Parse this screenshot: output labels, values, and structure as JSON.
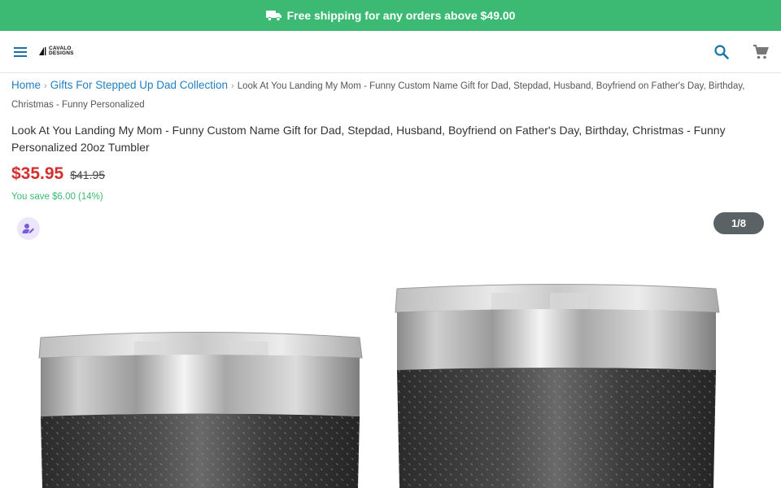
{
  "promo": {
    "text": "Free shipping for any orders above $49.00",
    "icon": "truck-icon",
    "background": "#3cba74"
  },
  "header": {
    "menu_icon": "hamburger-menu-icon",
    "logo_text_line1": "CAVALO",
    "logo_text_line2": "DESIGNS",
    "search_icon": "search-icon",
    "cart_icon": "cart-icon"
  },
  "breadcrumb": {
    "items": [
      "Home",
      "Gifts For Stepped Up Dad Collection"
    ],
    "current": "Look At You Landing My Mom - Funny Custom Name Gift for Dad, Stepdad, Husband, Boyfriend on Father's Day, Birthday, Christmas - Funny Personalized"
  },
  "product": {
    "title": "Look At You Landing My Mom - Funny Custom Name Gift for Dad, Stepdad, Husband, Boyfriend on Father's Day, Birthday, Christmas - Funny Personalized 20oz Tumbler",
    "price": "$35.95",
    "compare_price": "$41.95",
    "savings": "You save $6.00 (14%)",
    "price_color": "#d32f2f",
    "savings_color": "#3cba74",
    "personalize_icon": "person-edit-icon"
  },
  "gallery": {
    "counter": "1/8"
  }
}
